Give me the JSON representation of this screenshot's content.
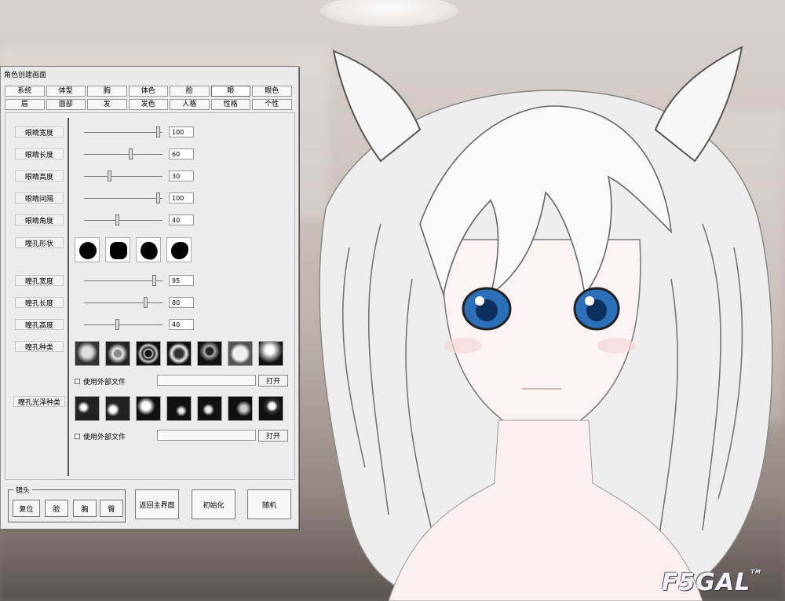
{
  "window": {
    "title": "角色创建画面"
  },
  "tabs": {
    "row1": [
      "系统",
      "体型",
      "胸",
      "体色",
      "脸",
      "眼",
      "眼色"
    ],
    "row2": [
      "眉",
      "面部",
      "发",
      "发色",
      "人格",
      "性格",
      "个性"
    ],
    "active": "眼"
  },
  "sliders": [
    {
      "label": "眼睛宽度",
      "value": "100",
      "level": 0.97
    },
    {
      "label": "眼睛长度",
      "value": "60",
      "level": 0.6
    },
    {
      "label": "眼睛高度",
      "value": "30",
      "level": 0.32
    },
    {
      "label": "眼睛间隔",
      "value": "100",
      "level": 0.97
    },
    {
      "label": "眼睛角度",
      "value": "40",
      "level": 0.42
    }
  ],
  "pupil_shape": {
    "label": "瞳孔形状",
    "options": [
      "circle",
      "rounded-square",
      "tilted-round",
      "blob"
    ]
  },
  "pupil_sliders": [
    {
      "label": "瞳孔宽度",
      "value": "95",
      "level": 0.92
    },
    {
      "label": "瞳孔长度",
      "value": "80",
      "level": 0.8
    },
    {
      "label": "瞳孔高度",
      "value": "40",
      "level": 0.42
    }
  ],
  "pupil_type": {
    "label": "瞳孔种类",
    "use_external": "使用外部文件",
    "open": "打开"
  },
  "highlight_type": {
    "label": "瞳孔光泽种类",
    "use_external": "使用外部文件",
    "open": "打开"
  },
  "camera": {
    "legend": "镜头",
    "buttons": [
      "复位",
      "脸",
      "胸",
      "臀"
    ]
  },
  "actions": {
    "back": "返回主界面",
    "init": "初始化",
    "random": "随机"
  },
  "watermark": {
    "text": "F5GAL",
    "mark": "TM"
  },
  "colors": {
    "eye_blue": "#2a6fb8",
    "hair_white": "#f4f4f4"
  }
}
